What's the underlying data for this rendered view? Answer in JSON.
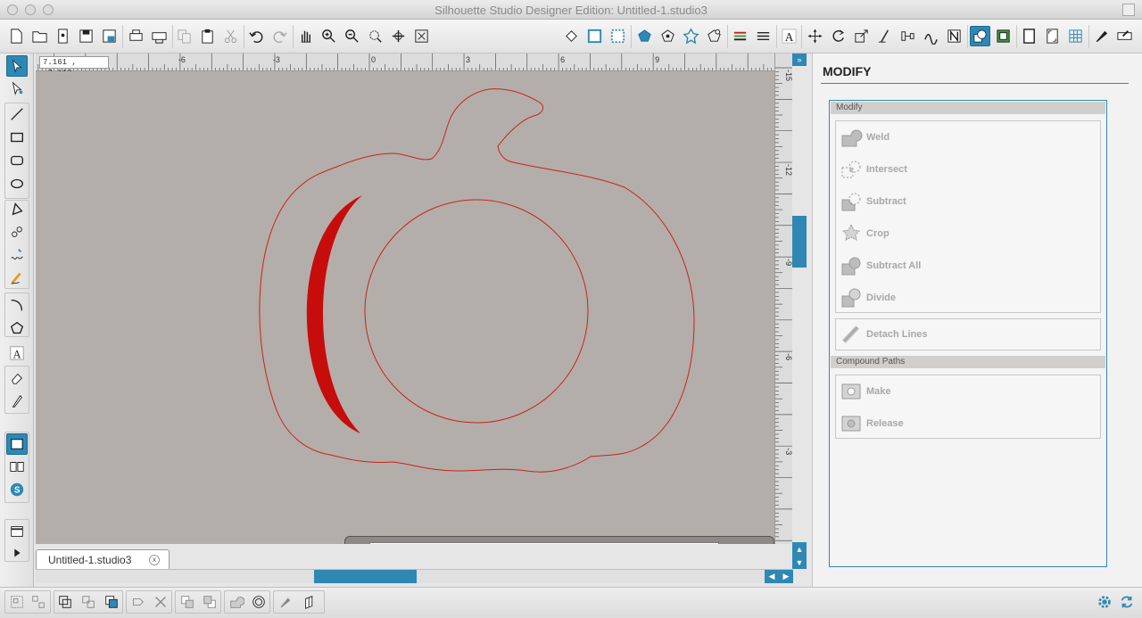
{
  "window": {
    "title": "Silhouette Studio Designer Edition: Untitled-1.studio3"
  },
  "canvas": {
    "coordinates": "7.161 , -7.113",
    "hruler_labels": [
      "-6",
      "-3",
      "0",
      "3",
      "6",
      "9"
    ],
    "vruler_labels": [
      "-15",
      "-12",
      "-9",
      "-6",
      "-3"
    ],
    "shape_color": "#c9221d",
    "bg_color": "#b4aeaa"
  },
  "document_tab": {
    "label": "Untitled-1.studio3",
    "close_symbol": "x"
  },
  "panel": {
    "title": "MODIFY",
    "modify_header": "Modify",
    "items": {
      "weld": "Weld",
      "intersect": "Intersect",
      "subtract": "Subtract",
      "crop": "Crop",
      "subtract_all": "Subtract All",
      "divide": "Divide",
      "detach_lines": "Detach Lines"
    },
    "compound_header": "Compound Paths",
    "compound": {
      "make": "Make",
      "release": "Release"
    }
  },
  "colors": {
    "accent": "#2f88b4"
  }
}
